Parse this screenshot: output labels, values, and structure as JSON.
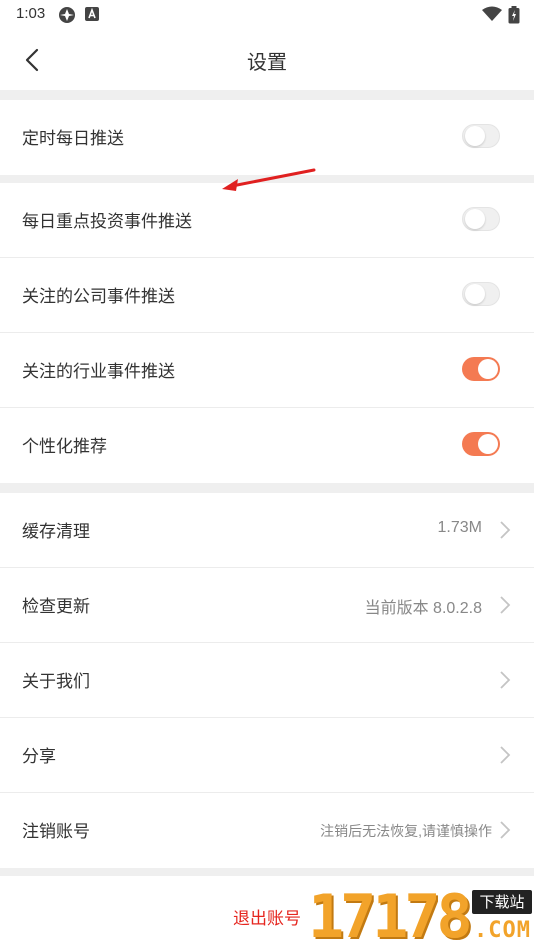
{
  "status_bar": {
    "time": "1:03",
    "icons": [
      "app-icon",
      "android-a-icon",
      "wifi-icon",
      "battery-icon"
    ]
  },
  "nav": {
    "back_icon": "chevron-left-icon",
    "title": "设置"
  },
  "sections": {
    "timed": {
      "label": "定时每日推送",
      "enabled": false
    },
    "push": [
      {
        "label": "每日重点投资事件推送",
        "enabled": false
      },
      {
        "label": "关注的公司事件推送",
        "enabled": false
      },
      {
        "label": "关注的行业事件推送",
        "enabled": true
      },
      {
        "label": "个性化推荐",
        "enabled": true
      }
    ],
    "general": [
      {
        "label": "缓存清理",
        "value": "1.73M"
      },
      {
        "label": "检查更新",
        "value": "当前版本 8.0.2.8"
      },
      {
        "label": "关于我们",
        "value": ""
      },
      {
        "label": "分享",
        "value": ""
      },
      {
        "label": "注销账号",
        "value": "注销后无法恢复,请谨慎操作"
      }
    ]
  },
  "logout": {
    "label": "退出账号"
  },
  "watermark": {
    "digits": "17178",
    "tag": "下载站",
    "suffix": ".COM"
  },
  "colors": {
    "accent": "#f47a52",
    "logout": "#e5261f",
    "annotation_arrow": "#e02020",
    "divider": "#efefef"
  }
}
